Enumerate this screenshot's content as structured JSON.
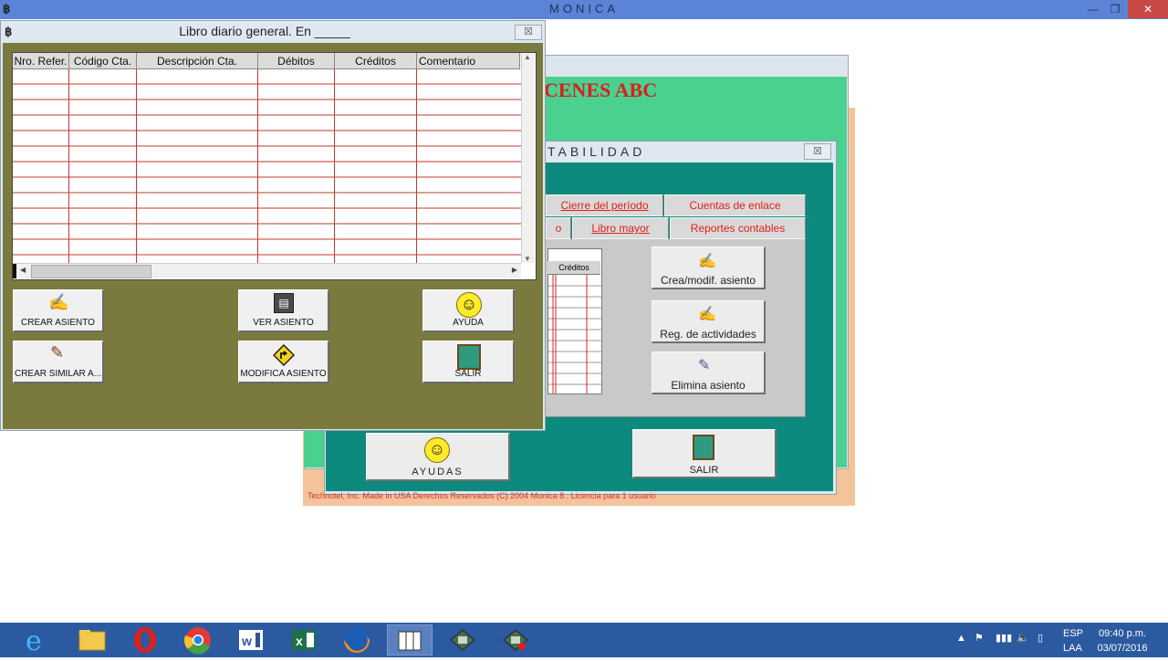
{
  "app": {
    "title": "MONICA"
  },
  "company": {
    "name": "CENES ABC"
  },
  "contabilidad": {
    "title": "TABILIDAD",
    "close": "☒",
    "tabs_row1": [
      "Cierre del período",
      "Cuentas de enlace"
    ],
    "tabs_row2": [
      "o",
      "Libro mayor",
      "Reportes contables"
    ],
    "mini_header": "Créditos",
    "buttons": [
      "Crea/modif. asiento",
      "Reg. de actividades",
      "Elimina asiento"
    ],
    "ayudas": "AYUDAS",
    "salir": "SALIR",
    "copyright": "Technotel, Inc.  Made in USA  Derechos Reservados (C) 2004  Monica 8 . Licencia para 1 usuario"
  },
  "libro": {
    "title": "Libro diario general.  En _____",
    "close": "☒",
    "columns": [
      "Nro. Refer.",
      "Código Cta.",
      "Descripción Cta.",
      "Débitos",
      "Créditos",
      "Comentario"
    ],
    "buttons": {
      "crear_asiento": "CREAR ASIENTO",
      "ver_asiento": "VER ASIENTO",
      "ayuda": "AYUDA",
      "crear_similar": "CREAR  SIMILAR  A...",
      "modifica_asiento": "MODIFICA ASIENTO",
      "salir": "SALIR"
    }
  },
  "taskbar": {
    "tray": {
      "lang": "ESP",
      "layout": "LAA",
      "time": "09:40 p.m.",
      "date": "03/07/2016"
    }
  },
  "colors": {
    "accent_red": "#e0201a",
    "teal": "#0b8a7d",
    "olive": "#7a7a3e",
    "green": "#4ad08f"
  }
}
